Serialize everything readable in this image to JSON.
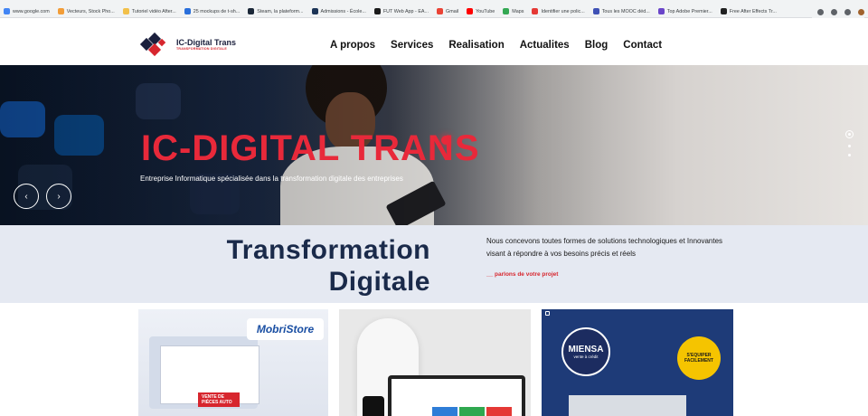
{
  "browser": {
    "bookmarks": [
      {
        "label": "www.google.com",
        "icon": "google-icon",
        "color": "#4285f4"
      },
      {
        "label": "Vecteurs, Stock Pho...",
        "icon": "vecteezy-icon",
        "color": "#f29d38"
      },
      {
        "label": "Tutoriel vidéo After...",
        "icon": "tutorial-icon",
        "color": "#f2c04a"
      },
      {
        "label": "25 mockups de t-sh...",
        "icon": "mockup-icon",
        "color": "#2a6fdb"
      },
      {
        "label": "Steam, la plateform...",
        "icon": "steam-icon",
        "color": "#1b2838"
      },
      {
        "label": "Admissions - École...",
        "icon": "school-icon",
        "color": "#1d3557"
      },
      {
        "label": "FUT Web App - EA...",
        "icon": "ea-icon",
        "color": "#1b1b1b"
      },
      {
        "label": "Gmail",
        "icon": "gmail-icon",
        "color": "#ea4335"
      },
      {
        "label": "YouTube",
        "icon": "youtube-icon",
        "color": "#ff0000"
      },
      {
        "label": "Maps",
        "icon": "maps-icon",
        "color": "#34a853"
      },
      {
        "label": "Identifier une polic...",
        "icon": "font-icon",
        "color": "#e53935"
      },
      {
        "label": "Tous les MOOC déd...",
        "icon": "mooc-icon",
        "color": "#3f51b5"
      },
      {
        "label": "Top Adobe Premier...",
        "icon": "adobe-icon",
        "color": "#6a45c9"
      },
      {
        "label": "Free After Effects Tr...",
        "icon": "ae-icon",
        "color": "#212121"
      }
    ]
  },
  "nav": {
    "logo_title": "IC-Digital Trans",
    "logo_subtitle": "TRANSFORMATION DIGITALE",
    "items": [
      "A propos",
      "Services",
      "Realisation",
      "Actualites",
      "Blog",
      "Contact"
    ]
  },
  "hero": {
    "title": "IC-DIGITAL TRANS",
    "subtitle": "Entreprise Informatique spécialisée dans la transformation digitale des entreprises",
    "prev_symbol": "‹",
    "next_symbol": "›",
    "accent": "#e8293a"
  },
  "intro": {
    "title_line1": "Transformation",
    "title_line2": "Digitale",
    "text": "Nous concevons toutes formes de solutions technologiques et Innovantes visant à répondre à vos besoins précis et réels",
    "link": "__ parlons de votre projet"
  },
  "projects": [
    {
      "brand": "MobriStore",
      "caption": "VENTE DE PIÈCES AUTO"
    },
    {
      "brand": "",
      "caption": ""
    },
    {
      "brand": "MIENSA",
      "caption": "vente à crédit",
      "badge": "S'EQUIPER FACILEMENT"
    }
  ]
}
